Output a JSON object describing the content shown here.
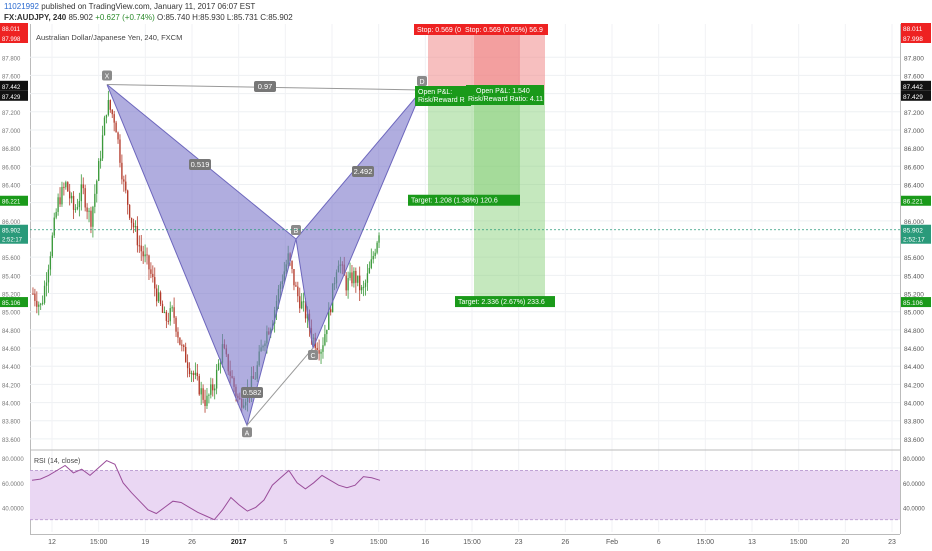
{
  "header": {
    "user": "11021992",
    "published": "published on TradingView.com, January 11, 2017 06:07 EST",
    "symbol": "FX:AUDJPY, 240",
    "last": "85.902",
    "change": "+0.627 (+0.74%)",
    "ohlc": "O:85.740 H:85.930 L:85.731 C:85.902"
  },
  "chart_title": "Australian Dollar/Japanese Yen, 240, FXCM",
  "colors": {
    "up": "#3c9a3c",
    "down": "#b33a2a",
    "pattern": "#7b76c9",
    "stop": "#f08080",
    "target": "#7ecb6e",
    "rsi": "#9a4d9a",
    "rsi_band": "#ead7f3"
  },
  "chart_data": [
    {
      "type": "candlestick",
      "title": "Australian Dollar/Japanese Yen, 240, FXCM",
      "ylim": [
        83.5,
        88.1
      ],
      "y_ticks": [
        "87.800",
        "87.600",
        "87.400",
        "87.200",
        "87.000",
        "86.800",
        "86.600",
        "86.400",
        "86.200",
        "86.000",
        "85.800",
        "85.600",
        "85.400",
        "85.200",
        "85.000",
        "84.800",
        "84.600",
        "84.400",
        "84.200",
        "84.000",
        "83.800",
        "83.600"
      ],
      "x_ticks": [
        "12",
        "15:00",
        "19",
        "26",
        "2017",
        "5",
        "9",
        "15:00",
        "16",
        "15:00",
        "23",
        "26",
        "Feb",
        "6",
        "15:00",
        "13",
        "15:00",
        "20",
        "23"
      ],
      "price_labels": [
        {
          "text": "88.011",
          "kind": "stop"
        },
        {
          "text": "87.998",
          "kind": "stop"
        },
        {
          "text": "87.442",
          "kind": "black"
        },
        {
          "text": "87.429",
          "kind": "black"
        },
        {
          "text": "86.221",
          "kind": "target"
        },
        {
          "text": "85.902",
          "kind": "last"
        },
        {
          "text": "2:52:17",
          "kind": "last"
        },
        {
          "text": "85.106",
          "kind": "target"
        }
      ],
      "close_path": [
        85.2,
        85.05,
        85.6,
        86.2,
        86.4,
        86.1,
        86.35,
        86.0,
        86.6,
        87.3,
        87.1,
        86.4,
        86.0,
        85.7,
        85.5,
        85.2,
        84.9,
        85.0,
        84.6,
        84.4,
        84.2,
        84.0,
        84.2,
        84.6,
        84.3,
        84.0,
        84.1,
        84.3,
        84.7,
        84.9,
        85.3,
        85.6,
        85.2,
        85.0,
        84.7,
        84.6,
        85.0,
        85.6,
        85.3,
        85.4,
        85.2,
        85.5,
        85.9
      ],
      "harmonic_pattern": {
        "points": [
          {
            "label": "X",
            "price": 87.5
          },
          {
            "label": "A",
            "price": 83.75
          },
          {
            "label": "B",
            "price": 85.8
          },
          {
            "label": "C",
            "price": 84.6
          },
          {
            "label": "D",
            "price": 87.44
          }
        ],
        "ratios": {
          "xb": "0.519",
          "ac": "0.582",
          "bd": "2.492",
          "xd": "0.97"
        }
      },
      "positions": [
        {
          "stop_label": "Stop: 0.569 (0",
          "pnl": "Open P&L:",
          "rr": "Risk/Reward R",
          "target": "Target: 1.208 (1.38%) 120.6"
        },
        {
          "stop_label": "Stop: 0.569 (0.65%) 56.9",
          "pnl": "Open P&L: 1.540",
          "rr": "Risk/Reward Ratio: 4.11",
          "target": "Target: 2.336 (2.67%) 233.6"
        }
      ],
      "last_price": 85.902
    },
    {
      "type": "line",
      "title": "RSI (14, close)",
      "ylim": [
        20,
        85
      ],
      "y_ticks": [
        "80.0000",
        "60.0000",
        "40.0000"
      ],
      "left_ticks": [
        "80.0000",
        "60.0000",
        "40.0000"
      ],
      "band": [
        30,
        70
      ],
      "values": [
        62,
        63,
        66,
        70,
        74,
        68,
        71,
        66,
        72,
        78,
        75,
        60,
        52,
        45,
        38,
        35,
        40,
        45,
        44,
        40,
        36,
        33,
        30,
        38,
        48,
        42,
        37,
        40,
        46,
        58,
        64,
        70,
        60,
        55,
        60,
        66,
        62,
        58,
        56,
        58,
        65,
        64,
        62
      ]
    }
  ]
}
